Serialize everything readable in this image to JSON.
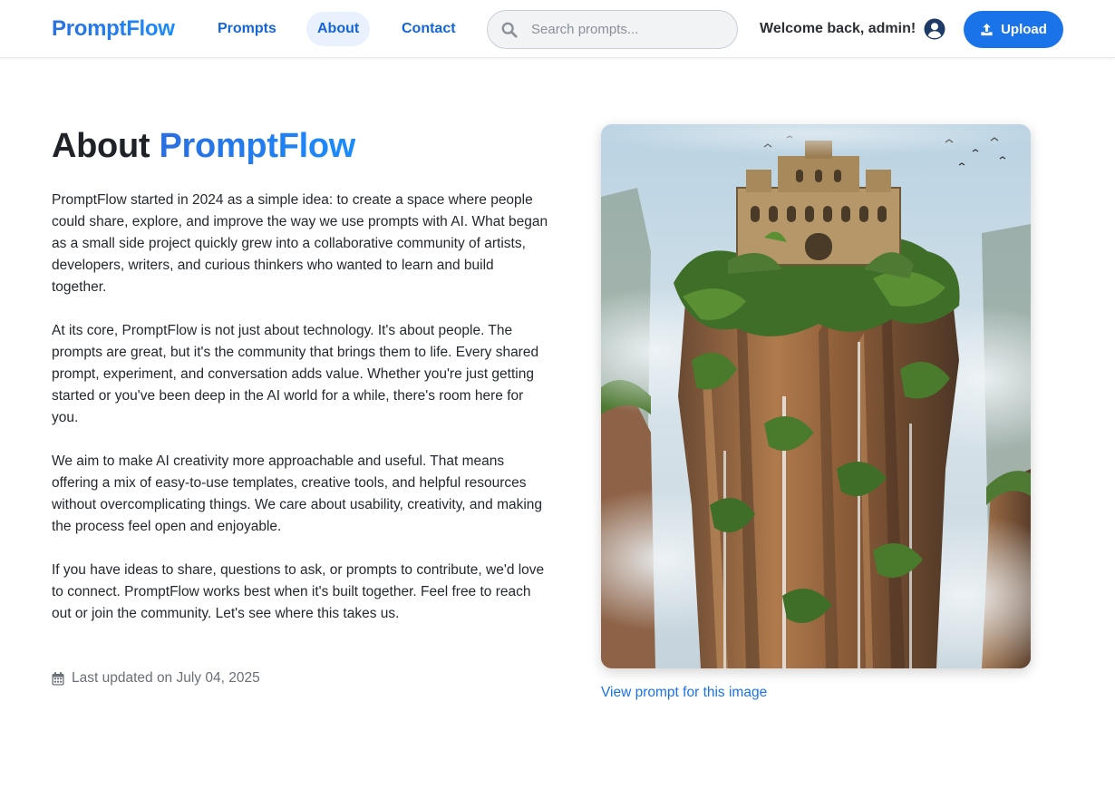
{
  "header": {
    "logo": "PromptFlow",
    "nav": [
      {
        "label": "Prompts"
      },
      {
        "label": "About",
        "active": true
      },
      {
        "label": "Contact"
      }
    ],
    "search": {
      "placeholder": "Search prompts...",
      "value": "",
      "icon": "search-icon"
    },
    "welcome": "Welcome back, admin!",
    "user_icon": "user-circle-icon",
    "upload_label": "Upload",
    "upload_icon": "upload-icon"
  },
  "main": {
    "title_prefix": "About ",
    "title_brand": "PromptFlow",
    "paragraphs": [
      "PromptFlow started in 2024 as a simple idea: to create a space where people could share, explore, and improve the way we use prompts with AI. What began as a small side project quickly grew into a collaborative community of artists, developers, writers, and curious thinkers who wanted to learn and build together.",
      "At its core, PromptFlow is not just about technology. It's about people. The prompts are great, but it's the community that brings them to life. Every shared prompt, experiment, and conversation adds value. Whether you're just getting started or you've been deep in the AI world for a while, there's room here for you.",
      "We aim to make AI creativity more approachable and useful. That means offering a mix of easy-to-use templates, creative tools, and helpful resources without overcomplicating things. We care about usability, creativity, and making the process feel open and enjoyable.",
      "If you have ideas to share, questions to ask, or prompts to contribute, we'd love to connect. PromptFlow works best when it's built together. Feel free to reach out or join the community. Let's see where this takes us."
    ],
    "last_updated": "Last updated on July 04, 2025",
    "calendar_icon": "calendar-icon",
    "image_link": "View prompt for this image"
  },
  "colors": {
    "accent": "#1a73e8",
    "nav_active_bg": "#e8f1fd",
    "text": "#24292f",
    "muted": "#6a7077"
  }
}
